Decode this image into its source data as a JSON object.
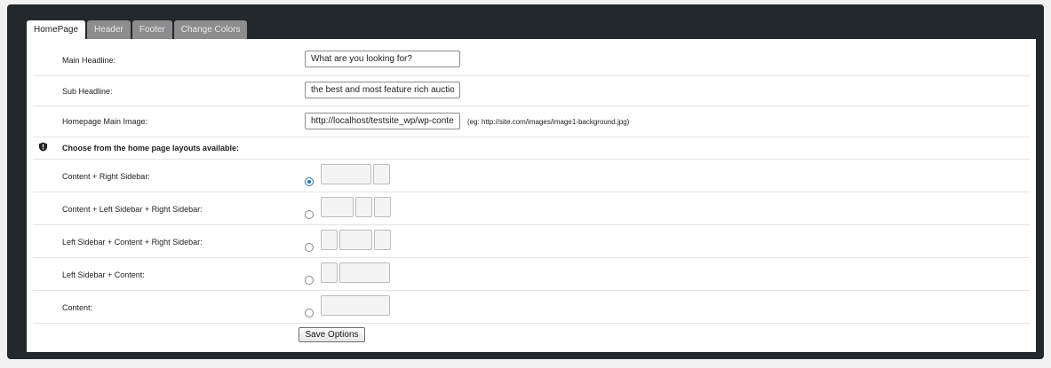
{
  "tabs": [
    {
      "label": "HomePage",
      "active": true
    },
    {
      "label": "Header",
      "active": false
    },
    {
      "label": "Footer",
      "active": false
    },
    {
      "label": "Change Colors",
      "active": false
    }
  ],
  "fields": {
    "main_headline": {
      "label": "Main Headline:",
      "value": "What are you looking for?"
    },
    "sub_headline": {
      "label": "Sub Headline:",
      "value": "the best and most feature rich auction"
    },
    "main_image": {
      "label": "Homepage Main Image:",
      "value": "http://localhost/testsite_wp/wp-content",
      "hint": "(eg: http://site.com/images/image1-background.jpg)"
    }
  },
  "layouts": {
    "heading": "Choose from the home page layouts available:",
    "heading_icon": "shield-icon",
    "options": [
      {
        "label": "Content + Right Sidebar:",
        "selected": true
      },
      {
        "label": "Content + Left Sidebar + Right Sidebar:",
        "selected": false
      },
      {
        "label": "Left Sidebar + Content + Right Sidebar:",
        "selected": false
      },
      {
        "label": "Left Sidebar + Content:",
        "selected": false
      },
      {
        "label": "Content:",
        "selected": false
      }
    ]
  },
  "save_label": "Save Options",
  "colors": {
    "frame": "#23282d",
    "active_radio": "#2271b1",
    "inactive_tab": "#8d8d8d"
  }
}
